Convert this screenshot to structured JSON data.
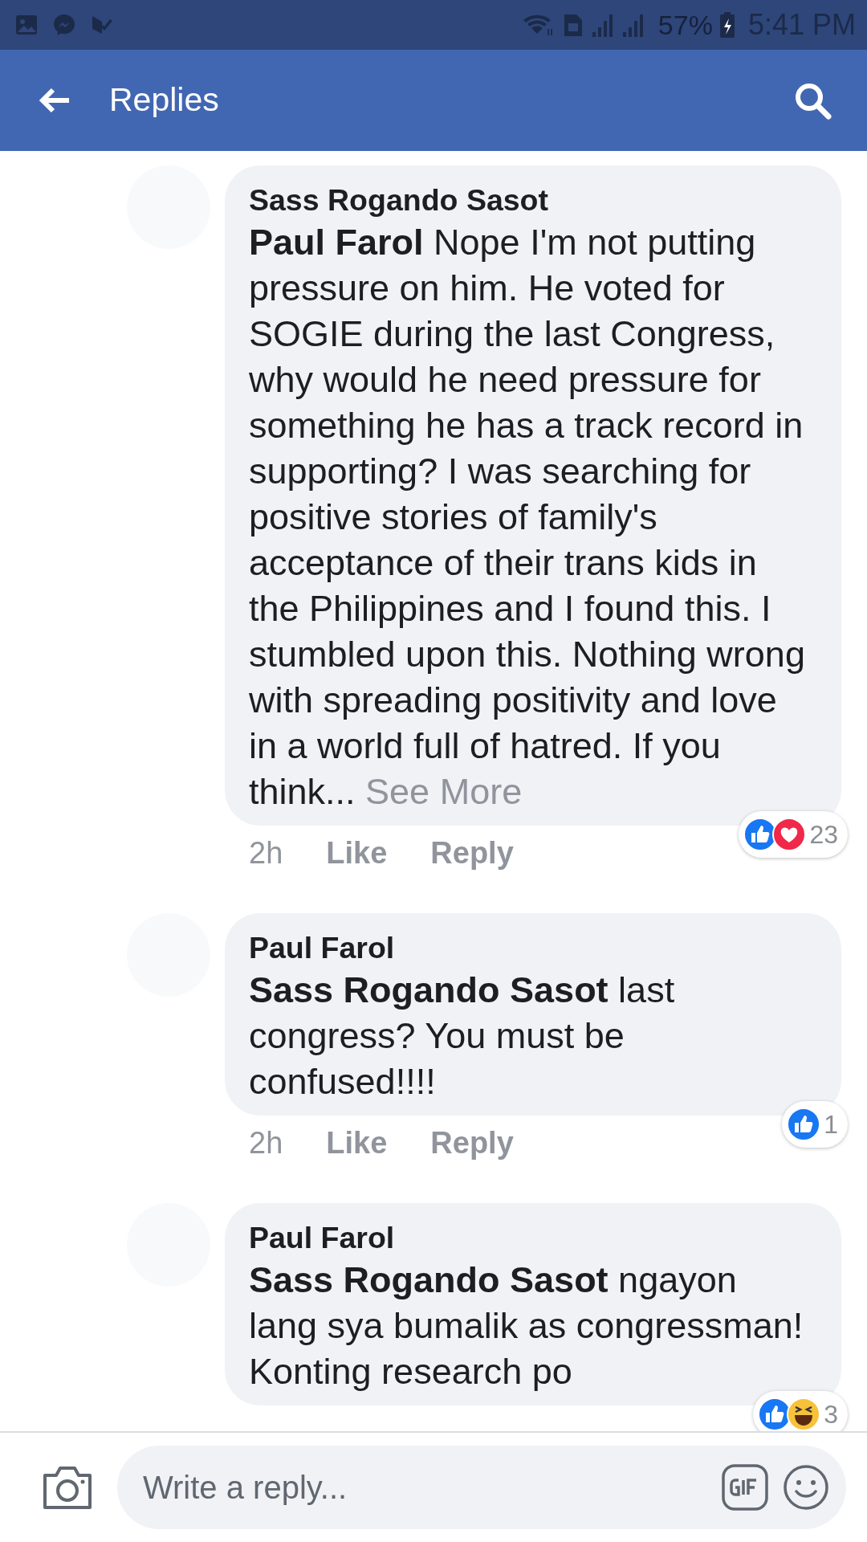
{
  "status_bar": {
    "battery": "57%",
    "time": "5:41 PM"
  },
  "header": {
    "title": "Replies"
  },
  "comments": [
    {
      "author": "Sass Rogando Sasot",
      "text": "**Paul Farol** Nope I'm not putting pressure on him. He voted for SOGIE during the last Congress, why would he need pressure for something he has a track record in supporting? I was searching for positive stories of family's acceptance of their trans kids in the Philippines and I found this. I stumbled upon this. Nothing wrong with spreading positivity and love in a world full of hatred. If you think...",
      "see_more": "See More",
      "time": "2h",
      "like": "Like",
      "reply": "Reply",
      "reactions": [
        {
          "kind": "like"
        },
        {
          "kind": "love"
        }
      ],
      "reaction_count": "23"
    },
    {
      "author": "Paul Farol",
      "text": "**Sass Rogando Sasot** last congress? You must be confused!!!!",
      "time": "2h",
      "like": "Like",
      "reply": "Reply",
      "reactions": [
        {
          "kind": "like"
        }
      ],
      "reaction_count": "1"
    },
    {
      "author": "Paul Farol",
      "text": "**Sass Rogando Sasot** ngayon lang sya bumalik as congressman! Konting research po",
      "reactions": [
        {
          "kind": "like"
        },
        {
          "kind": "haha"
        }
      ],
      "reaction_count": "3"
    }
  ],
  "composer": {
    "placeholder": "Write a reply..."
  }
}
